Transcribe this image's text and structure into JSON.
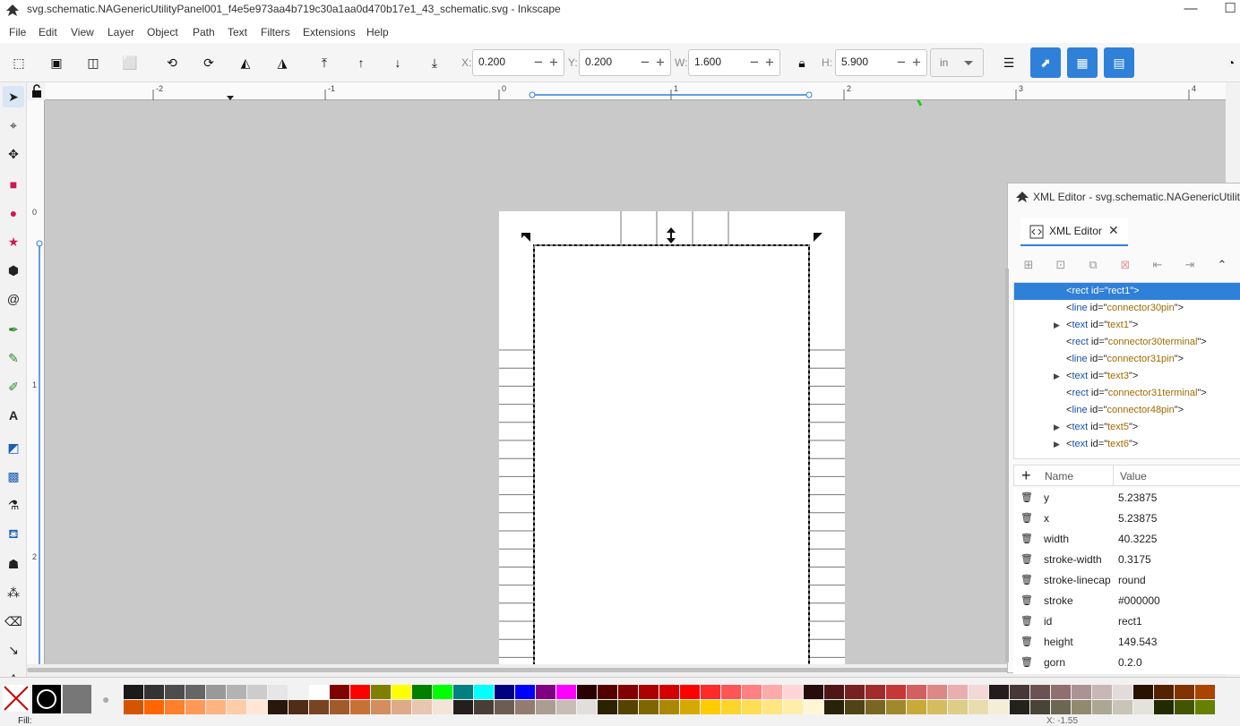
{
  "window": {
    "title": "svg.schematic.NAGenericUtilityPanel001_f4e5e973aa4b719c30a1aa0d470b17e1_43_schematic.svg - Inkscape",
    "minimize": "—",
    "maximize": "☐"
  },
  "menu": [
    "File",
    "Edit",
    "View",
    "Layer",
    "Object",
    "Path",
    "Text",
    "Filters",
    "Extensions",
    "Help"
  ],
  "toolbar": {
    "x_label": "X:",
    "x_value": "0.200",
    "y_label": "Y:",
    "y_value": "0.200",
    "w_label": "W:",
    "w_value": "1.600",
    "h_label": "H:",
    "h_value": "5.900",
    "unit": "in",
    "minus": "−",
    "plus": "+"
  },
  "ruler": {
    "h_labels": [
      "-2",
      "-1",
      "0",
      "1",
      "2",
      "3",
      "4"
    ],
    "v_labels": [
      "0",
      "1",
      "2"
    ]
  },
  "xml_editor": {
    "title": "XML Editor - svg.schematic.NAGenericUtility",
    "tab_label": "XML Editor",
    "nodes": [
      {
        "tag": "rect",
        "id": "rect1",
        "expandable": false,
        "selected": true
      },
      {
        "tag": "line",
        "id": "connector30pin",
        "expandable": false,
        "selected": false
      },
      {
        "tag": "text",
        "id": "text1",
        "expandable": true,
        "selected": false
      },
      {
        "tag": "rect",
        "id": "connector30terminal",
        "expandable": false,
        "selected": false
      },
      {
        "tag": "line",
        "id": "connector31pin",
        "expandable": false,
        "selected": false
      },
      {
        "tag": "text",
        "id": "text3",
        "expandable": true,
        "selected": false
      },
      {
        "tag": "rect",
        "id": "connector31terminal",
        "expandable": false,
        "selected": false
      },
      {
        "tag": "line",
        "id": "connector48pin",
        "expandable": false,
        "selected": false
      },
      {
        "tag": "text",
        "id": "text5",
        "expandable": true,
        "selected": false
      },
      {
        "tag": "text",
        "id": "text6",
        "expandable": true,
        "selected": false
      }
    ],
    "attr_header": {
      "name": "Name",
      "value": "Value"
    },
    "attributes": [
      {
        "name": "y",
        "value": "5.23875"
      },
      {
        "name": "x",
        "value": "5.23875"
      },
      {
        "name": "width",
        "value": "40.3225"
      },
      {
        "name": "stroke-width",
        "value": "0.3175"
      },
      {
        "name": "stroke-linecap",
        "value": "round"
      },
      {
        "name": "stroke",
        "value": "#000000"
      },
      {
        "name": "id",
        "value": "rect1"
      },
      {
        "name": "height",
        "value": "149.543"
      },
      {
        "name": "gorn",
        "value": "0.2.0"
      }
    ]
  },
  "statusbar": {
    "fill_label": "Fill:",
    "coord_x": "X: -1.55"
  },
  "colors": {
    "accent": "#2f80d8",
    "annotation": "#22cc22",
    "canvas_bg": "#c9c9c9"
  },
  "palette": [
    [
      "#1a1a1a",
      "#333333",
      "#4d4d4d",
      "#666666",
      "#999999",
      "#b3b3b3",
      "#cccccc",
      "#e6e6e6",
      "#f2f2f2",
      "#ffffff",
      "#800000",
      "#ff0000",
      "#808000",
      "#ffff00",
      "#008000",
      "#00ff00",
      "#008080",
      "#00ffff",
      "#000080",
      "#0000ff",
      "#800080",
      "#ff00ff",
      "#2b0000",
      "#550000",
      "#800000",
      "#aa0000",
      "#d40000",
      "#ff0000",
      "#ff2a2a",
      "#ff5555",
      "#ff8080",
      "#ffaaaa",
      "#ffd5d5",
      "#280b0b",
      "#501616",
      "#782121",
      "#a02c2c",
      "#c83737",
      "#d35f5f",
      "#de8787",
      "#e9afaf",
      "#f4d7d7",
      "#241c1c",
      "#483737",
      "#6c5353",
      "#916f6f",
      "#ac9393",
      "#c8b7b7",
      "#e3dbdb",
      "#2b1100",
      "#552200",
      "#803300",
      "#aa4400"
    ],
    [
      "#d45500",
      "#ff6600",
      "#ff7f2a",
      "#ff9955",
      "#ffb380",
      "#ffccaa",
      "#ffe6d5",
      "#28170b",
      "#502d16",
      "#784421",
      "#a05a2c",
      "#c87137",
      "#d38d5f",
      "#deaa87",
      "#e9c6af",
      "#f4e3d7",
      "#241f1c",
      "#483e37",
      "#6c5d53",
      "#917c6f",
      "#ac9d93",
      "#c8beb7",
      "#e3dedb",
      "#2b2200",
      "#554400",
      "#806600",
      "#aa8800",
      "#d4aa00",
      "#ffcc00",
      "#ffd42a",
      "#ffdd55",
      "#ffe680",
      "#ffeeaa",
      "#fff6d5",
      "#28220b",
      "#504416",
      "#786721",
      "#a0892c",
      "#c8ab37",
      "#d4bc5f",
      "#decd87",
      "#e9ddaf",
      "#f4eed7",
      "#24221c",
      "#484537",
      "#6c6753",
      "#918a6f",
      "#aca793",
      "#c8c4b7",
      "#e3e2db",
      "#222b00",
      "#445500",
      "#668000"
    ]
  ]
}
